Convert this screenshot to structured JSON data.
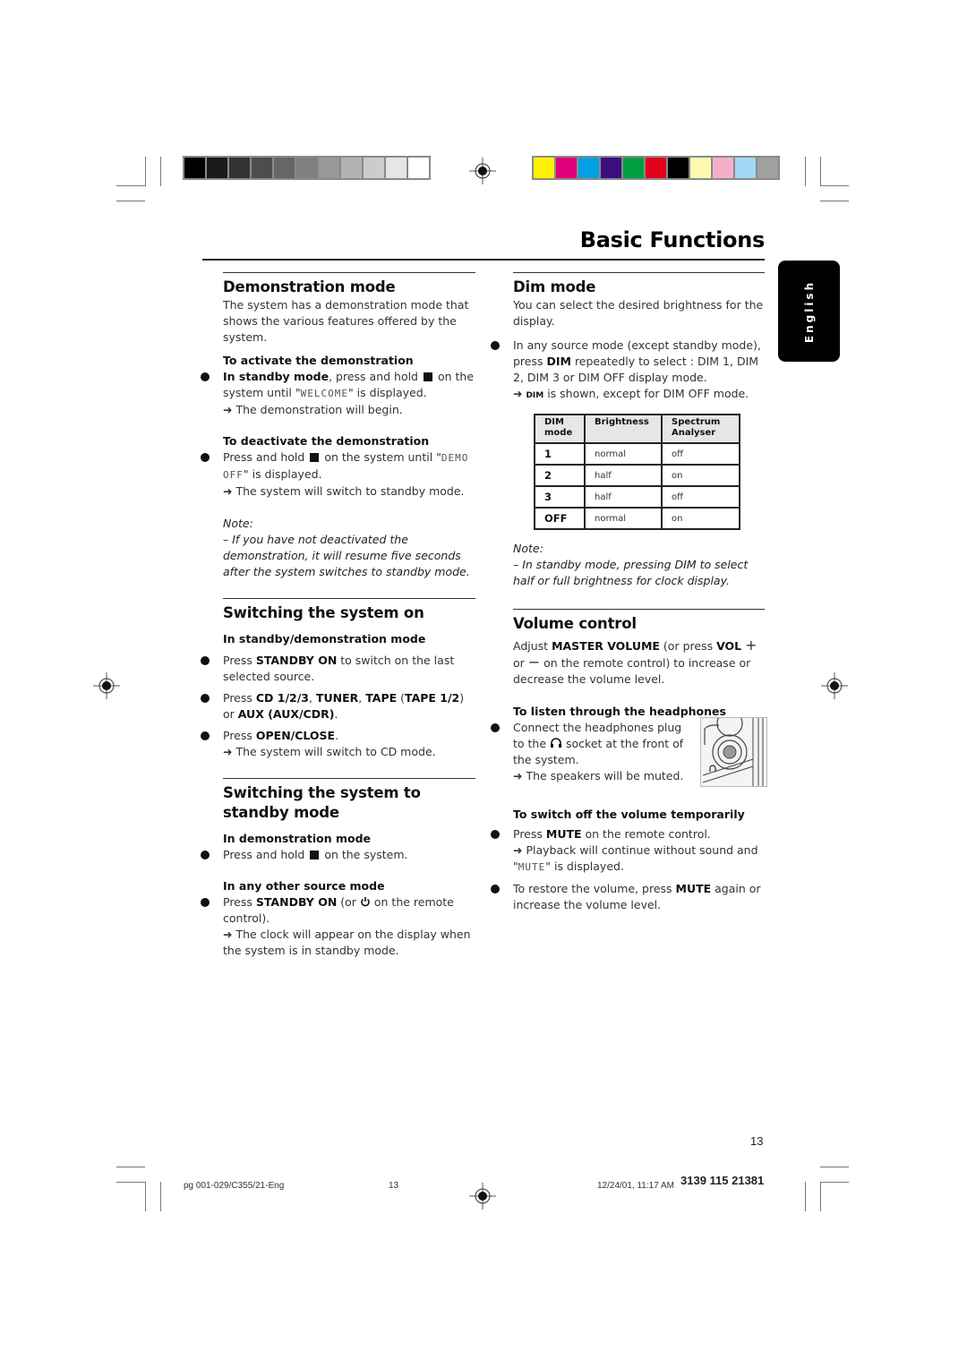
{
  "print_marks": {
    "grayscale": [
      "#000000",
      "#1a1a1a",
      "#333333",
      "#4d4d4d",
      "#666666",
      "#808080",
      "#999999",
      "#b3b3b3",
      "#cccccc",
      "#e6e6e6",
      "#ffffff"
    ],
    "colors": [
      "#fff200",
      "#e2007a",
      "#00a0e3",
      "#3c0f80",
      "#00a040",
      "#e2001a",
      "#000000",
      "#fff9b0",
      "#f5b0c8",
      "#a0d8f5",
      "#a0a0a0"
    ]
  },
  "header": {
    "title": "Basic Functions"
  },
  "language_tab": "English",
  "left": {
    "demo": {
      "title": "Demonstration mode",
      "intro": "The system has a demonstration mode that shows the various features offered by the system.",
      "activate_heading": "To activate the demonstration",
      "activate_b1": "In standby mode",
      "activate_t1": ", press and hold",
      "activate_t2": "on the system until \"",
      "activate_lcd": "WELCOME",
      "activate_t3": "\" is displayed.",
      "activate_arrow": "The demonstration will begin.",
      "deactivate_heading": "To deactivate the demonstration",
      "deactivate_t1": "Press and hold",
      "deactivate_t2": "on the system until \"",
      "deactivate_lcd": "DEMO OFF",
      "deactivate_t3": "\" is displayed.",
      "deactivate_arrow": "The system will switch to standby mode.",
      "note_label": "Note:",
      "note_text": "–  If you have not deactivated the demonstration, it will resume five seconds after the system switches to standby mode."
    },
    "switch_on": {
      "title": "Switching the system on",
      "sub": "In standby/demonstration mode",
      "b1_pre": "Press ",
      "b1_bold": "STANDBY ON",
      "b1_post": " to switch on the last selected source.",
      "b2_pre": "Press ",
      "b2_bold1": "CD 1/2/3",
      "b2_sep1": ", ",
      "b2_bold2": "TUNER",
      "b2_sep2": ", ",
      "b2_bold3": "TAPE",
      "b2_sep3": " (",
      "b2_bold4": "TAPE 1/2",
      "b2_sep4": ") or ",
      "b2_bold5": "AUX (AUX/CDR)",
      "b2_end": ".",
      "b3_pre": "Press ",
      "b3_bold": "OPEN/CLOSE",
      "b3_end": ".",
      "b3_arrow": "The system will switch to CD mode."
    },
    "standby": {
      "title": "Switching the system to standby mode",
      "sub1": "In demonstration mode",
      "s1_t1": "Press and hold",
      "s1_t2": "on the system.",
      "sub2": "In any other source mode",
      "s2_pre": "Press ",
      "s2_bold": "STANDBY ON",
      "s2_mid": " (or ",
      "s2_post": " on the remote control).",
      "s2_arrow": "The clock will appear on the display when the system is in standby mode."
    }
  },
  "right": {
    "dim": {
      "title": "Dim mode",
      "intro": "You can select the desired brightness for the display.",
      "b1_pre": "In any source mode (except standby mode), press ",
      "b1_bold": "DIM",
      "b1_post": " repeatedly to select : DIM 1, DIM 2, DIM 3 or DIM OFF display mode.",
      "arrow_small": "DIM",
      "arrow_text": " is shown, except for DIM OFF mode.",
      "table": {
        "headers": [
          "DIM mode",
          "Brightness",
          "Spectrum Analyser"
        ],
        "rows": [
          [
            "1",
            "normal",
            "off"
          ],
          [
            "2",
            "half",
            "on"
          ],
          [
            "3",
            "half",
            "off"
          ],
          [
            "OFF",
            "normal",
            "on"
          ]
        ]
      },
      "note_label": "Note:",
      "note_text": "–  In standby mode, pressing DIM to select half or full brightness for clock display."
    },
    "volume": {
      "title": "Volume control",
      "p_pre": "Adjust ",
      "p_bold1": "MASTER VOLUME",
      "p_mid": " (or press ",
      "p_bold2": "VOL",
      "p_plus": "+",
      "p_or": " or ",
      "p_minus": "−",
      "p_post": " on the remote control) to increase or decrease the volume level.",
      "hp_heading": "To listen through the headphones",
      "hp_t1": "Connect the headphones plug to the",
      "hp_t2": "socket at the front of the system.",
      "hp_arrow": "The speakers will be muted.",
      "mute_heading": "To switch off the volume temporarily",
      "m1_pre": "Press ",
      "m1_bold": "MUTE",
      "m1_post": " on the remote control.",
      "m1_arrow": "Playback will continue without sound and \"",
      "m1_lcd": "MUTE",
      "m1_arrow_end": "\" is displayed.",
      "m2_pre": "To restore the volume, press ",
      "m2_bold": "MUTE",
      "m2_post": " again or increase the volume level."
    }
  },
  "page_number": "13",
  "footer": {
    "file": "pg 001-029/C355/21-Eng",
    "page": "13",
    "datetime": "12/24/01, 11:17 AM",
    "code": "3139 115 21381"
  }
}
